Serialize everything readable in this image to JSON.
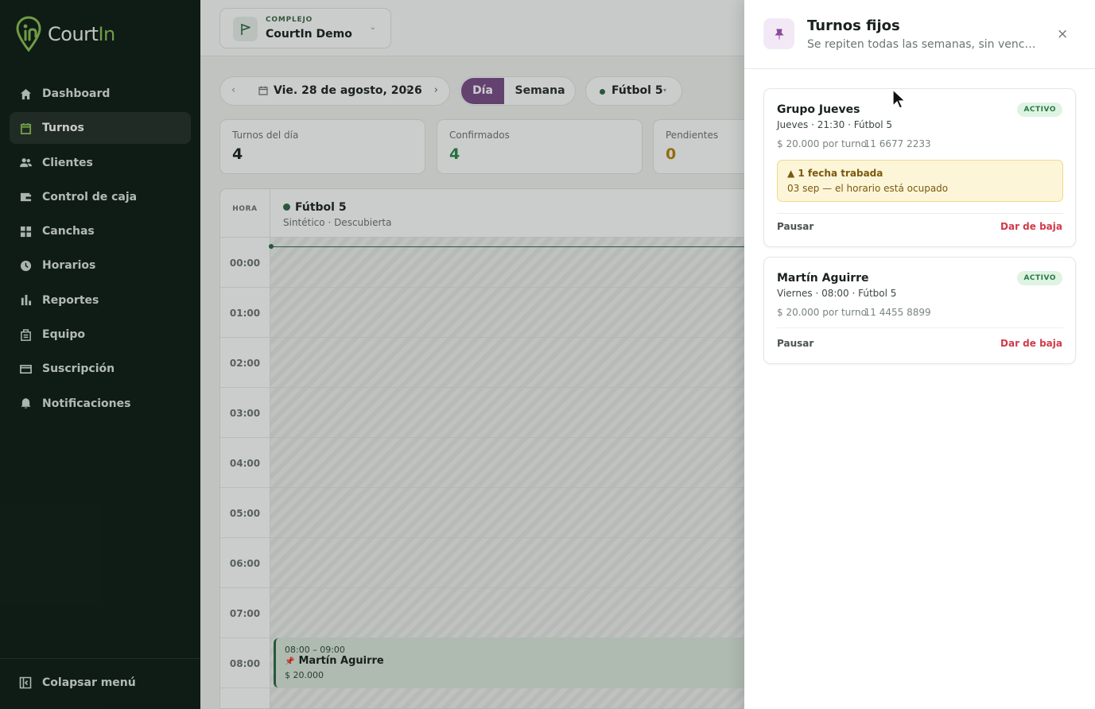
{
  "sidebar": {
    "brand": "CourtIn",
    "brand_first": "Court",
    "brand_second": "In",
    "items": [
      {
        "label": "Dashboard",
        "icon": "home-icon"
      },
      {
        "label": "Turnos",
        "icon": "calendar-icon",
        "active": true
      },
      {
        "label": "Clientes",
        "icon": "users-icon"
      },
      {
        "label": "Control de caja",
        "icon": "wallet-icon"
      },
      {
        "label": "Canchas",
        "icon": "grid-icon"
      },
      {
        "label": "Horarios",
        "icon": "clock-icon"
      },
      {
        "label": "Reportes",
        "icon": "bar-chart-icon"
      },
      {
        "label": "Equipo",
        "icon": "team-icon"
      },
      {
        "label": "Suscripción",
        "icon": "card-icon"
      },
      {
        "label": "Notificaciones",
        "icon": "bell-icon"
      }
    ],
    "collapse_label": "Colapsar menú"
  },
  "topbar": {
    "complex_label": "COMPLEJO",
    "complex_name": "CourtIn Demo"
  },
  "toolbar": {
    "date": "Vie. 28 de agosto, 2026",
    "view_day": "Día",
    "view_week": "Semana",
    "sport": "Fútbol 5"
  },
  "stats": [
    {
      "label": "Turnos del día",
      "value": "4",
      "color": "#1d2520"
    },
    {
      "label": "Confirmados",
      "value": "4",
      "color": "#2a8a4a"
    },
    {
      "label": "Pendientes",
      "value": "0",
      "color": "#b8860b"
    }
  ],
  "grid": {
    "hour_header": "HORA",
    "court_name": "Fútbol 5",
    "court_sub": "Sintético · Descubierta",
    "hours": [
      "00:00",
      "01:00",
      "02:00",
      "03:00",
      "04:00",
      "05:00",
      "06:00",
      "07:00",
      "08:00"
    ],
    "booking": {
      "time": "08:00 – 09:00",
      "name": "Martín Aguirre",
      "price": "$ 20.000"
    }
  },
  "drawer": {
    "title": "Turnos fijos",
    "subtitle": "Se repiten todas las semanas, sin venci...",
    "close": "×",
    "cards": [
      {
        "name": "Grupo Jueves",
        "status": "ACTIVO",
        "detail": "Jueves · 21:30 · Fútbol 5",
        "price": "$ 20.000 por turno",
        "phone": "· 11 6677 2233",
        "warning_title": "1 fecha trabada",
        "warning_detail": "03 sep — el horario está ocupado",
        "pause": "Pausar",
        "drop": "Dar de baja"
      },
      {
        "name": "Martín Aguirre",
        "status": "ACTIVO",
        "detail": "Viernes · 08:00 · Fútbol 5",
        "price": "$ 20.000 por turno",
        "phone": "· 11 4455 8899",
        "pause": "Pausar",
        "drop": "Dar de baja"
      }
    ]
  },
  "colors": {
    "sidebar_bg": "#0f1d17",
    "accent_green": "#8cc152",
    "view_active": "#7a4d8a",
    "danger": "#d23a4a"
  }
}
